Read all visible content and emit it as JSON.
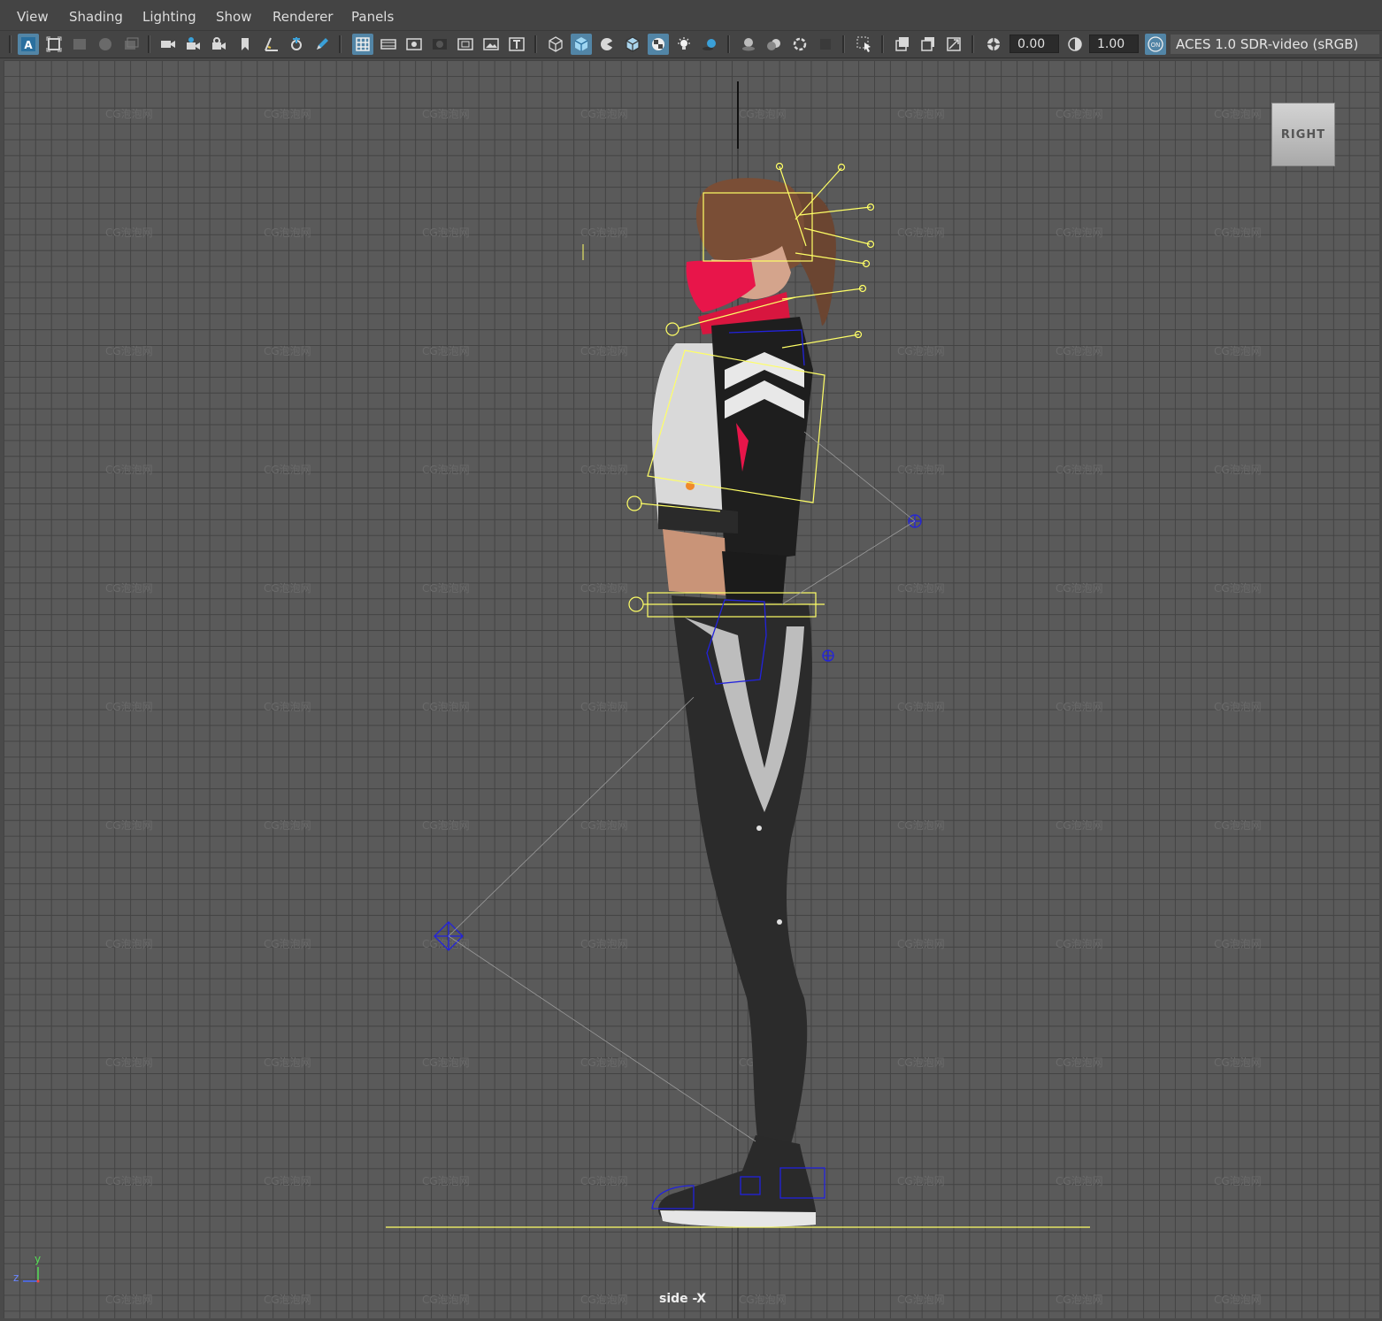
{
  "menu": [
    "View",
    "Shading",
    "Lighting",
    "Show",
    "Renderer",
    "Panels"
  ],
  "toolbar": {
    "exposure_value": "0.00",
    "gamma_value": "1.00",
    "color_management_badge": "ON",
    "color_space": "ACES 1.0 SDR-video (sRGB)"
  },
  "viewport": {
    "view_cube_label": "RIGHT",
    "camera_name": "side -X",
    "axis_labels": {
      "y": "y",
      "z": "z"
    },
    "watermark_text": "CG泡泡网"
  },
  "colors": {
    "grid_background": "#5a5a5a",
    "grid_line": "#434343",
    "controller_yellow": "#ffff66",
    "joint_blue": "#2222dd",
    "active_button": "#5285a6",
    "mask_red": "#e8154a"
  }
}
